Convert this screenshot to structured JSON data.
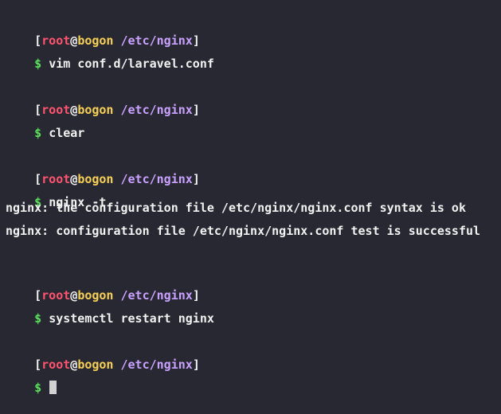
{
  "terminal": {
    "blocks": [
      {
        "prompt": {
          "open": "[",
          "user": "root",
          "at": "@",
          "host": "bogon",
          "path": "/etc/nginx",
          "close": "]"
        },
        "dollar": "$",
        "command": "vim conf.d/laravel.conf",
        "output": []
      },
      {
        "prompt": {
          "open": "[",
          "user": "root",
          "at": "@",
          "host": "bogon",
          "path": "/etc/nginx",
          "close": "]"
        },
        "dollar": "$",
        "command": "clear",
        "output": []
      },
      {
        "prompt": {
          "open": "[",
          "user": "root",
          "at": "@",
          "host": "bogon",
          "path": "/etc/nginx",
          "close": "]"
        },
        "dollar": "$",
        "command": "nginx -t",
        "output": [
          "nginx: the configuration file /etc/nginx/nginx.conf syntax is ok",
          "nginx: configuration file /etc/nginx/nginx.conf test is successful"
        ]
      },
      {
        "prompt": {
          "open": "[",
          "user": "root",
          "at": "@",
          "host": "bogon",
          "path": "/etc/nginx",
          "close": "]"
        },
        "dollar": "$",
        "command": "systemctl restart nginx",
        "output": []
      },
      {
        "prompt": {
          "open": "[",
          "user": "root",
          "at": "@",
          "host": "bogon",
          "path": "/etc/nginx",
          "close": "]"
        },
        "dollar": "$",
        "command": "",
        "output": []
      }
    ]
  },
  "colors": {
    "background": "#272831",
    "user": "#ff5470",
    "host": "#f6cf57",
    "path": "#c9a1ff",
    "dollar": "#5be05b",
    "text": "#f1f1f1"
  }
}
